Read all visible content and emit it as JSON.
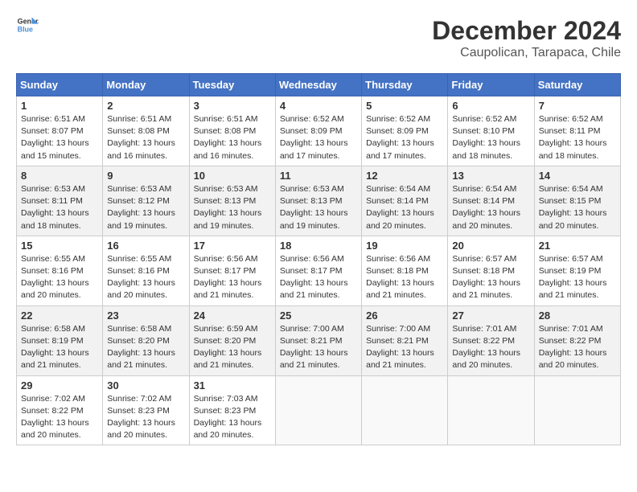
{
  "header": {
    "logo": {
      "general": "General",
      "blue": "Blue"
    },
    "title": "December 2024",
    "subtitle": "Caupolican, Tarapaca, Chile"
  },
  "calendar": {
    "headers": [
      "Sunday",
      "Monday",
      "Tuesday",
      "Wednesday",
      "Thursday",
      "Friday",
      "Saturday"
    ],
    "weeks": [
      [
        {
          "day": "1",
          "sunrise": "6:51 AM",
          "sunset": "8:07 PM",
          "daylight": "13 hours and 15 minutes."
        },
        {
          "day": "2",
          "sunrise": "6:51 AM",
          "sunset": "8:08 PM",
          "daylight": "13 hours and 16 minutes."
        },
        {
          "day": "3",
          "sunrise": "6:51 AM",
          "sunset": "8:08 PM",
          "daylight": "13 hours and 16 minutes."
        },
        {
          "day": "4",
          "sunrise": "6:52 AM",
          "sunset": "8:09 PM",
          "daylight": "13 hours and 17 minutes."
        },
        {
          "day": "5",
          "sunrise": "6:52 AM",
          "sunset": "8:09 PM",
          "daylight": "13 hours and 17 minutes."
        },
        {
          "day": "6",
          "sunrise": "6:52 AM",
          "sunset": "8:10 PM",
          "daylight": "13 hours and 18 minutes."
        },
        {
          "day": "7",
          "sunrise": "6:52 AM",
          "sunset": "8:11 PM",
          "daylight": "13 hours and 18 minutes."
        }
      ],
      [
        {
          "day": "8",
          "sunrise": "6:53 AM",
          "sunset": "8:11 PM",
          "daylight": "13 hours and 18 minutes."
        },
        {
          "day": "9",
          "sunrise": "6:53 AM",
          "sunset": "8:12 PM",
          "daylight": "13 hours and 19 minutes."
        },
        {
          "day": "10",
          "sunrise": "6:53 AM",
          "sunset": "8:13 PM",
          "daylight": "13 hours and 19 minutes."
        },
        {
          "day": "11",
          "sunrise": "6:53 AM",
          "sunset": "8:13 PM",
          "daylight": "13 hours and 19 minutes."
        },
        {
          "day": "12",
          "sunrise": "6:54 AM",
          "sunset": "8:14 PM",
          "daylight": "13 hours and 20 minutes."
        },
        {
          "day": "13",
          "sunrise": "6:54 AM",
          "sunset": "8:14 PM",
          "daylight": "13 hours and 20 minutes."
        },
        {
          "day": "14",
          "sunrise": "6:54 AM",
          "sunset": "8:15 PM",
          "daylight": "13 hours and 20 minutes."
        }
      ],
      [
        {
          "day": "15",
          "sunrise": "6:55 AM",
          "sunset": "8:16 PM",
          "daylight": "13 hours and 20 minutes."
        },
        {
          "day": "16",
          "sunrise": "6:55 AM",
          "sunset": "8:16 PM",
          "daylight": "13 hours and 20 minutes."
        },
        {
          "day": "17",
          "sunrise": "6:56 AM",
          "sunset": "8:17 PM",
          "daylight": "13 hours and 21 minutes."
        },
        {
          "day": "18",
          "sunrise": "6:56 AM",
          "sunset": "8:17 PM",
          "daylight": "13 hours and 21 minutes."
        },
        {
          "day": "19",
          "sunrise": "6:56 AM",
          "sunset": "8:18 PM",
          "daylight": "13 hours and 21 minutes."
        },
        {
          "day": "20",
          "sunrise": "6:57 AM",
          "sunset": "8:18 PM",
          "daylight": "13 hours and 21 minutes."
        },
        {
          "day": "21",
          "sunrise": "6:57 AM",
          "sunset": "8:19 PM",
          "daylight": "13 hours and 21 minutes."
        }
      ],
      [
        {
          "day": "22",
          "sunrise": "6:58 AM",
          "sunset": "8:19 PM",
          "daylight": "13 hours and 21 minutes."
        },
        {
          "day": "23",
          "sunrise": "6:58 AM",
          "sunset": "8:20 PM",
          "daylight": "13 hours and 21 minutes."
        },
        {
          "day": "24",
          "sunrise": "6:59 AM",
          "sunset": "8:20 PM",
          "daylight": "13 hours and 21 minutes."
        },
        {
          "day": "25",
          "sunrise": "7:00 AM",
          "sunset": "8:21 PM",
          "daylight": "13 hours and 21 minutes."
        },
        {
          "day": "26",
          "sunrise": "7:00 AM",
          "sunset": "8:21 PM",
          "daylight": "13 hours and 21 minutes."
        },
        {
          "day": "27",
          "sunrise": "7:01 AM",
          "sunset": "8:22 PM",
          "daylight": "13 hours and 20 minutes."
        },
        {
          "day": "28",
          "sunrise": "7:01 AM",
          "sunset": "8:22 PM",
          "daylight": "13 hours and 20 minutes."
        }
      ],
      [
        {
          "day": "29",
          "sunrise": "7:02 AM",
          "sunset": "8:22 PM",
          "daylight": "13 hours and 20 minutes."
        },
        {
          "day": "30",
          "sunrise": "7:02 AM",
          "sunset": "8:23 PM",
          "daylight": "13 hours and 20 minutes."
        },
        {
          "day": "31",
          "sunrise": "7:03 AM",
          "sunset": "8:23 PM",
          "daylight": "13 hours and 20 minutes."
        },
        null,
        null,
        null,
        null
      ]
    ]
  }
}
